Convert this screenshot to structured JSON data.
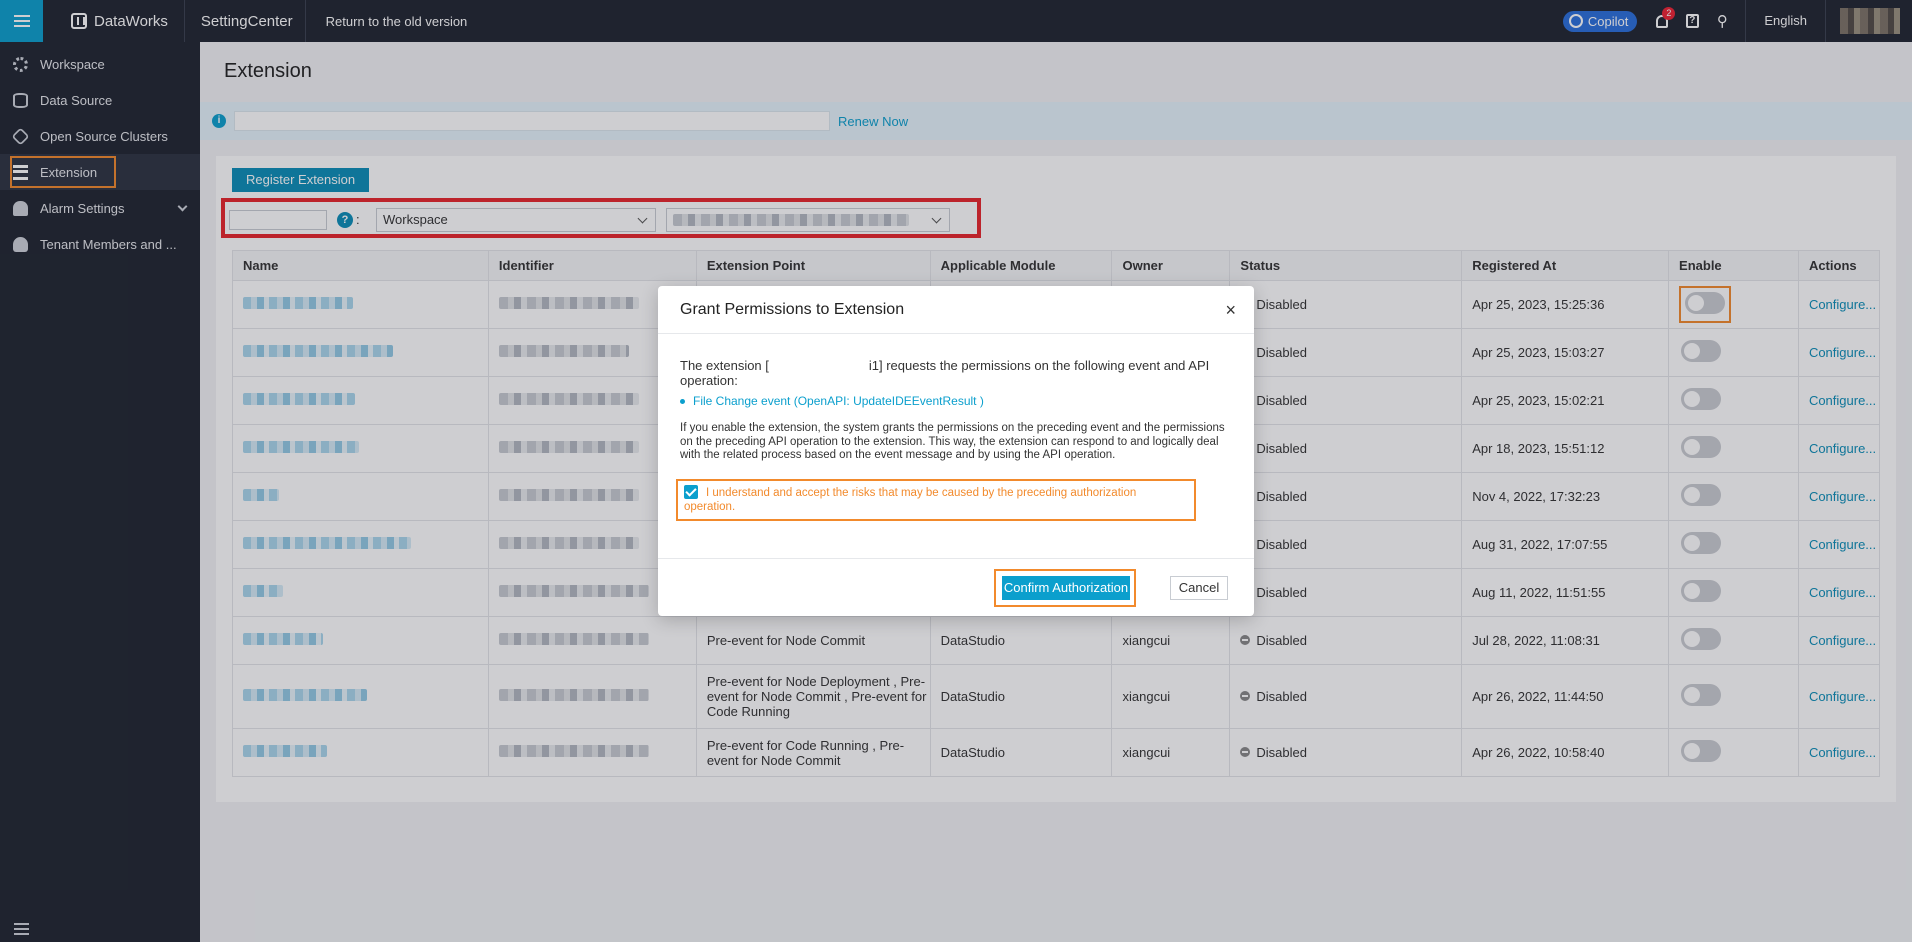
{
  "topbar": {
    "brand": "DataWorks",
    "section": "SettingCenter",
    "old_version": "Return to the old version",
    "copilot": "Copilot",
    "notif_count": "2",
    "help": "?",
    "language": "English"
  },
  "sidebar": {
    "items": [
      {
        "label": "Workspace",
        "icon": "gear-icon"
      },
      {
        "label": "Data Source",
        "icon": "database-icon"
      },
      {
        "label": "Open Source Clusters",
        "icon": "cluster-icon"
      },
      {
        "label": "Extension",
        "icon": "extension-icon",
        "active": true
      },
      {
        "label": "Alarm Settings",
        "icon": "alarm-icon"
      },
      {
        "label": "Tenant Members and ...",
        "icon": "users-icon"
      }
    ]
  },
  "page": {
    "title": "Extension",
    "renew": "Renew Now",
    "register_button": "Register Extension",
    "filter_help": "?",
    "filter_colon": ":",
    "filter_scope": "Workspace"
  },
  "table": {
    "headers": [
      "Name",
      "Identifier",
      "Extension Point",
      "Applicable Module",
      "Owner",
      "Status",
      "Registered At",
      "Enable",
      "Actions"
    ],
    "rows": [
      {
        "extension_point": "",
        "module": "",
        "owner": "",
        "status": "Disabled",
        "registered": "Apr 25, 2023, 15:25:36",
        "action": "Configure..."
      },
      {
        "extension_point": "",
        "module": "",
        "owner": "",
        "status": "Disabled",
        "registered": "Apr 25, 2023, 15:03:27",
        "action": "Configure..."
      },
      {
        "extension_point": "",
        "module": "",
        "owner": "",
        "status": "Disabled",
        "registered": "Apr 25, 2023, 15:02:21",
        "action": "Configure..."
      },
      {
        "extension_point": "",
        "module": "",
        "owner": "",
        "status": "Disabled",
        "registered": "Apr 18, 2023, 15:51:12",
        "action": "Configure..."
      },
      {
        "extension_point": "",
        "module": "",
        "owner": "",
        "status": "Disabled",
        "registered": "Nov 4, 2022, 17:32:23",
        "action": "Configure..."
      },
      {
        "extension_point": "",
        "module": "",
        "owner": "",
        "status": "Disabled",
        "registered": "Aug 31, 2022, 17:07:55",
        "action": "Configure..."
      },
      {
        "extension_point": "",
        "module": "",
        "owner": "",
        "status": "Disabled",
        "registered": "Aug 11, 2022, 11:51:55",
        "action": "Configure..."
      },
      {
        "extension_point": "Pre-event for Node Commit",
        "module": "DataStudio",
        "owner": "xiangcui",
        "status": "Disabled",
        "registered": "Jul 28, 2022, 11:08:31",
        "action": "Configure..."
      },
      {
        "extension_point": "Pre-event for Node Deployment , Pre-event for Node Commit , Pre-event for Code Running",
        "module": "DataStudio",
        "owner": "xiangcui",
        "status": "Disabled",
        "registered": "Apr 26, 2022, 11:44:50",
        "action": "Configure..."
      },
      {
        "extension_point": "Pre-event for Code Running , Pre-event for Node Commit",
        "module": "DataStudio",
        "owner": "xiangcui",
        "status": "Disabled",
        "registered": "Apr 26, 2022, 10:58:40",
        "action": "Configure..."
      }
    ]
  },
  "modal": {
    "title": "Grant Permissions to Extension",
    "close": "×",
    "intro_a": "The extension [",
    "intro_b": "i1] requests the permissions on the following event and API operation:",
    "event": "File Change event (OpenAPI: UpdateIDEEventResult )",
    "description": "If you enable the extension, the system grants the permissions on the preceding event and the permissions on the preceding API operation to the extension. This way, the extension can respond to and logically deal with the related process based on the event message and by using the API operation.",
    "acknowledge": "I understand and accept the risks that may be caused by the preceding authorization operation.",
    "confirm": "Confirm Authorization",
    "cancel": "Cancel"
  },
  "colors": {
    "accent": "#0b9fcd",
    "highlight_orange": "#f28a2c",
    "highlight_red": "#e8252b",
    "sidebar_bg": "#1f2430"
  }
}
